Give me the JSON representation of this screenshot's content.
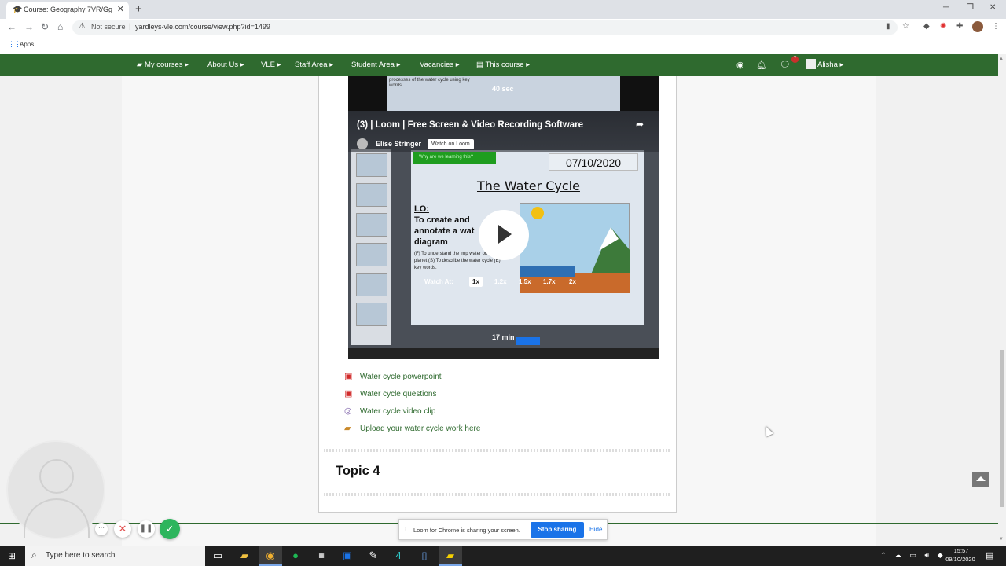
{
  "browser": {
    "tab_title": "Course: Geography 7VR/Gg",
    "tab_close": "✕",
    "new_tab": "+",
    "security_label": "Not secure",
    "url": "yardleys-vle.com/course/view.php?id=1499",
    "bookmarks_apps": "Apps",
    "window_controls": {
      "minimize": "─",
      "maximize": "❐",
      "close": "✕"
    }
  },
  "navbar": {
    "items": [
      {
        "label": "My courses ▸"
      },
      {
        "label": "About Us ▸"
      },
      {
        "label": "VLE ▸"
      },
      {
        "label": "Staff Area ▸"
      },
      {
        "label": "Student Area ▸"
      },
      {
        "label": "Vacancies ▸"
      },
      {
        "label": "This course ▸"
      }
    ],
    "message_count": "7",
    "user_name": "Alisha ▸"
  },
  "video_prev": {
    "slide_text": "processes of the water cycle using key words.",
    "duration": "40 sec"
  },
  "video_main": {
    "title": "(3) | Loom | Free Screen & Video Recording Software",
    "author": "Elise Stringer",
    "watch_on": "Watch on Loom",
    "slide_banner": "Why are we learning this?",
    "slide_date": "07/10/2020",
    "slide_title": "The Water Cycle",
    "lo_heading": "LO:",
    "lo_text": "To create and annotate a wat diagram",
    "lo_sub": "(F) To understand the imp water on our planet (S) To describe the water cycle (E) key words.",
    "watch_at": "Watch At:",
    "speeds": [
      "1x",
      "1.2x",
      "1.5x",
      "1.7x",
      "2x"
    ],
    "duration": "17 min"
  },
  "resources": [
    {
      "label": "Water cycle powerpoint",
      "icon": "pdf-icon"
    },
    {
      "label": "Water cycle questions",
      "icon": "pdf-icon"
    },
    {
      "label": "Water cycle video clip",
      "icon": "video-icon"
    },
    {
      "label": "Upload your water cycle work here",
      "icon": "upload-icon"
    }
  ],
  "topic_heading": "Topic 4",
  "sharing_bar": {
    "message": "Loom for Chrome is sharing your screen.",
    "stop_label": "Stop sharing",
    "hide_label": "Hide"
  },
  "taskbar": {
    "search_placeholder": "Type here to search",
    "time": "15:57",
    "date": "09/10/2020"
  },
  "colors": {
    "nav_green": "#2f6a2f",
    "link_green": "#2f6a2f",
    "share_blue": "#1a73e8",
    "done_green": "#2db55d"
  }
}
